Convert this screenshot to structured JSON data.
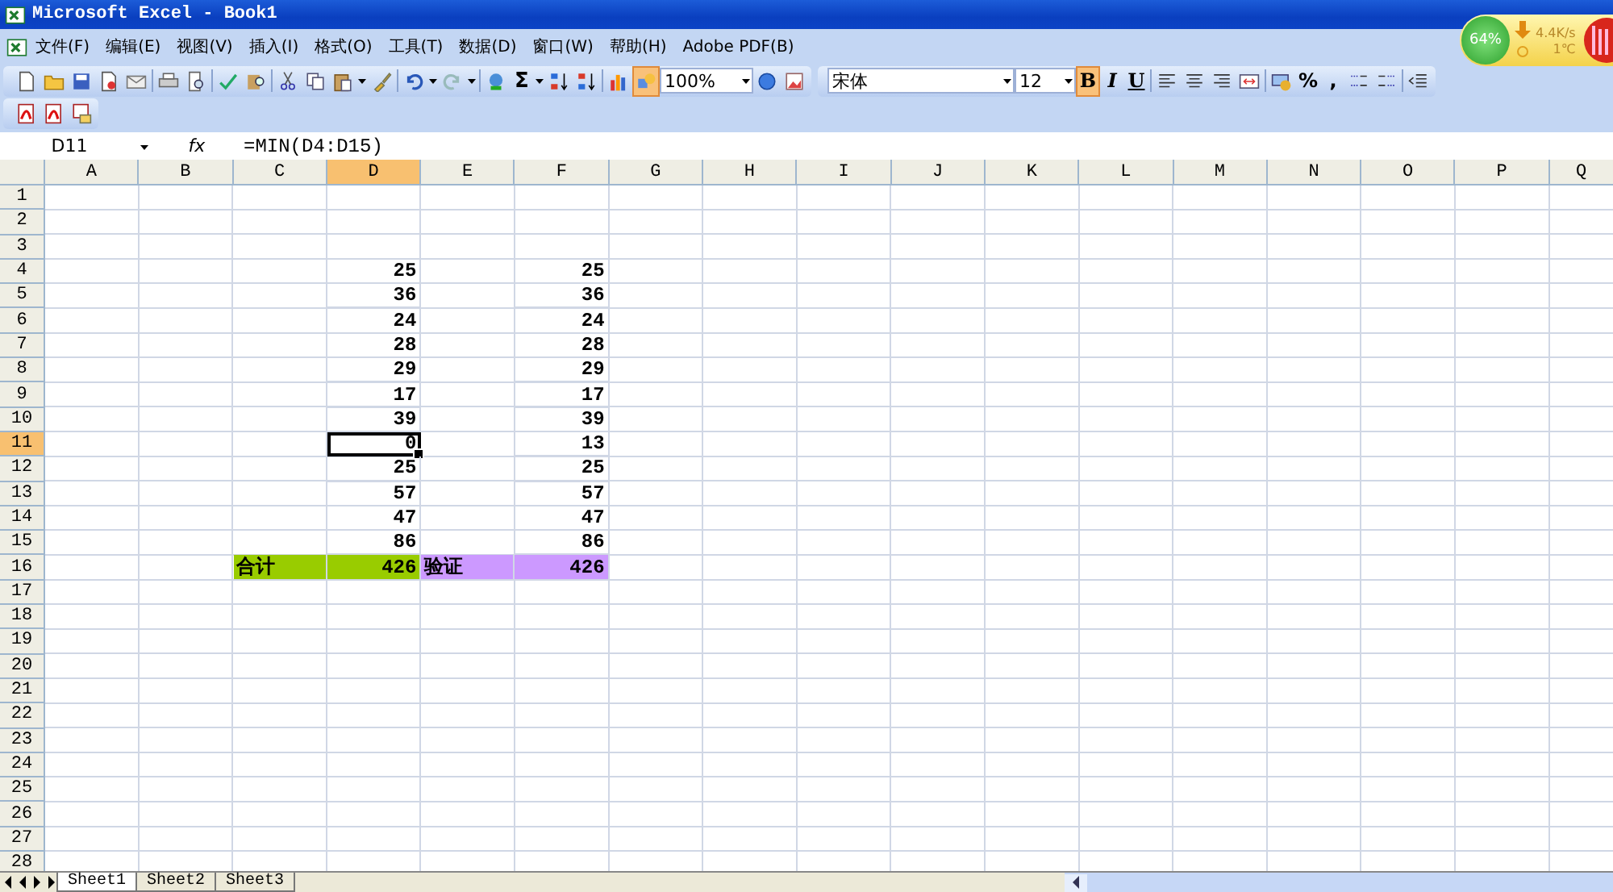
{
  "window": {
    "title": "Microsoft Excel - Book1"
  },
  "menu": [
    "文件(F)",
    "编辑(E)",
    "视图(V)",
    "插入(I)",
    "格式(O)",
    "工具(T)",
    "数据(D)",
    "窗口(W)",
    "帮助(H)",
    "Adobe PDF(B)"
  ],
  "standard_toolbar": {
    "sum": "Σ",
    "drawing_button": {
      "pressed": true
    },
    "zoom": "100%"
  },
  "formatting_toolbar": {
    "font": "宋体",
    "size": "12",
    "styles": [
      {
        "label": "B",
        "pressed": true
      },
      {
        "label": "I",
        "pressed": false
      },
      {
        "label": "U",
        "pressed": false
      }
    ],
    "number_buttons": [
      "%",
      ","
    ]
  },
  "formula_bar": {
    "name_box": "D11",
    "fx": "fx",
    "formula": "=MIN(D4:D15)"
  },
  "columns": [
    {
      "label": "A",
      "selected": false
    },
    {
      "label": "B",
      "selected": false
    },
    {
      "label": "C",
      "selected": false
    },
    {
      "label": "D",
      "selected": true
    },
    {
      "label": "E",
      "selected": false
    },
    {
      "label": "F",
      "selected": false
    },
    {
      "label": "G",
      "selected": false
    },
    {
      "label": "H",
      "selected": false
    },
    {
      "label": "I",
      "selected": false
    },
    {
      "label": "J",
      "selected": false
    },
    {
      "label": "K",
      "selected": false
    },
    {
      "label": "L",
      "selected": false
    },
    {
      "label": "M",
      "selected": false
    },
    {
      "label": "N",
      "selected": false
    },
    {
      "label": "O",
      "selected": false
    },
    {
      "label": "P",
      "selected": false
    },
    {
      "label": "Q",
      "selected": false
    }
  ],
  "rows": [
    {
      "header": "1",
      "selected": false
    },
    {
      "header": "2",
      "selected": false
    },
    {
      "header": "3",
      "selected": false
    },
    {
      "header": "4",
      "selected": false,
      "cells": [
        null,
        null,
        null,
        "25",
        null,
        "25"
      ]
    },
    {
      "header": "5",
      "selected": false,
      "cells": [
        null,
        null,
        null,
        "36",
        null,
        "36"
      ]
    },
    {
      "header": "6",
      "selected": false,
      "cells": [
        null,
        null,
        null,
        "24",
        null,
        "24"
      ]
    },
    {
      "header": "7",
      "selected": false,
      "cells": [
        null,
        null,
        null,
        "28",
        null,
        "28"
      ]
    },
    {
      "header": "8",
      "selected": false,
      "cells": [
        null,
        null,
        null,
        "29",
        null,
        "29"
      ]
    },
    {
      "header": "9",
      "selected": false,
      "cells": [
        null,
        null,
        null,
        "17",
        null,
        "17"
      ]
    },
    {
      "header": "10",
      "selected": false,
      "cells": [
        null,
        null,
        null,
        "39",
        null,
        "39"
      ]
    },
    {
      "header": "11",
      "selected": true,
      "cells": [
        null,
        null,
        null,
        {
          "value": "0",
          "selected": true
        },
        null,
        "13"
      ]
    },
    {
      "header": "12",
      "selected": false,
      "cells": [
        null,
        null,
        null,
        "25",
        null,
        "25"
      ]
    },
    {
      "header": "13",
      "selected": false,
      "cells": [
        null,
        null,
        null,
        "57",
        null,
        "57"
      ]
    },
    {
      "header": "14",
      "selected": false,
      "cells": [
        null,
        null,
        null,
        "47",
        null,
        "47"
      ]
    },
    {
      "header": "15",
      "selected": false,
      "cells": [
        null,
        null,
        null,
        "86",
        null,
        "86"
      ]
    },
    {
      "header": "16",
      "selected": false,
      "cells": [
        null,
        null,
        {
          "value": "合计",
          "kind": "label",
          "color": "#99cc00"
        },
        {
          "value": "426",
          "color": "#99cc00"
        },
        {
          "value": "验证",
          "kind": "label",
          "color": "#cc99ff"
        },
        {
          "value": "426",
          "color": "#cc99ff"
        }
      ]
    },
    {
      "header": "17",
      "selected": false
    },
    {
      "header": "18",
      "selected": false
    },
    {
      "header": "19",
      "selected": false
    },
    {
      "header": "20",
      "selected": false
    },
    {
      "header": "21",
      "selected": false
    },
    {
      "header": "22",
      "selected": false
    },
    {
      "header": "23",
      "selected": false
    },
    {
      "header": "24",
      "selected": false
    },
    {
      "header": "25",
      "selected": false
    },
    {
      "header": "26",
      "selected": false
    },
    {
      "header": "27",
      "selected": false
    },
    {
      "header": "28",
      "selected": false
    }
  ],
  "sheet_tabs": [
    {
      "label": "Sheet1",
      "selected": true
    },
    {
      "label": "Sheet2",
      "selected": false
    },
    {
      "label": "Sheet3",
      "selected": false
    }
  ],
  "widget": {
    "cpu": "64%",
    "speed": "4.4K/s",
    "temperature": "1℃"
  }
}
